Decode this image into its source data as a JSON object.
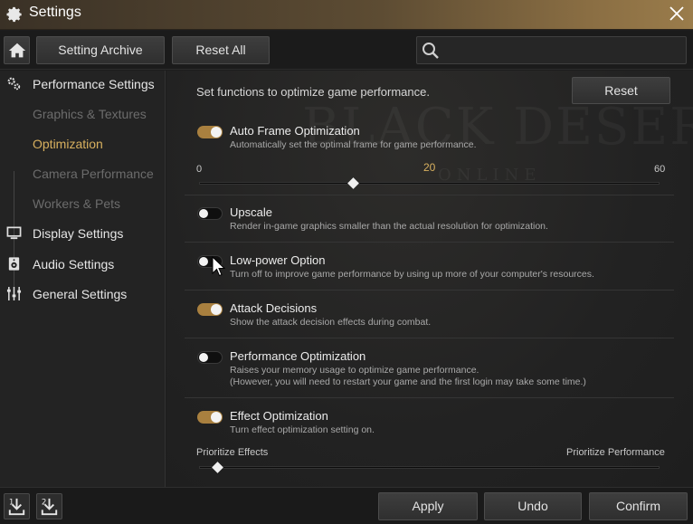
{
  "window": {
    "title": "Settings"
  },
  "toolbar": {
    "setting_archive_label": "Setting Archive",
    "reset_all_label": "Reset All",
    "search_value": "",
    "search_placeholder": ""
  },
  "sidebar": {
    "items": [
      {
        "label": "Performance Settings",
        "level": "main",
        "icon": "performance-gears-icon"
      },
      {
        "label": "Graphics & Textures",
        "level": "sub"
      },
      {
        "label": "Optimization",
        "level": "sub",
        "active": true
      },
      {
        "label": "Camera Performance",
        "level": "sub"
      },
      {
        "label": "Workers & Pets",
        "level": "sub"
      },
      {
        "label": "Display Settings",
        "level": "main",
        "icon": "monitor-icon"
      },
      {
        "label": "Audio Settings",
        "level": "main",
        "icon": "speaker-icon"
      },
      {
        "label": "General Settings",
        "level": "main",
        "icon": "sliders-icon"
      }
    ]
  },
  "content": {
    "intro": "Set functions to optimize game performance.",
    "reset_label": "Reset",
    "options": [
      {
        "name": "Auto Frame Optimization",
        "desc": "Automatically set the optimal frame for game performance.",
        "on": true
      },
      {
        "name": "Upscale",
        "desc": "Render in-game graphics smaller than the actual resolution for optimization.",
        "on": false
      },
      {
        "name": "Low-power Option",
        "desc": "Turn off to improve game performance by using up more of your computer's resources.",
        "on": false
      },
      {
        "name": "Attack Decisions",
        "desc": "Show the attack decision effects during combat.",
        "on": true
      },
      {
        "name": "Performance Optimization",
        "desc": "Raises your memory usage to optimize game performance.",
        "desc2": "(However, you will need to restart your game and the first login may take some time.)",
        "on": false
      },
      {
        "name": "Effect Optimization",
        "desc": "Turn effect optimization setting on.",
        "on": true
      }
    ],
    "frame_slider": {
      "min": "0",
      "max": "60",
      "value": "20",
      "value_num": 20,
      "min_num": 0,
      "max_num": 60
    },
    "effect_slider": {
      "left_label": "Prioritize Effects",
      "right_label": "Prioritize Performance",
      "position_fraction": 0.04
    }
  },
  "footer": {
    "apply_label": "Apply",
    "undo_label": "Undo",
    "confirm_label": "Confirm"
  },
  "colors": {
    "accent": "#d8b05f",
    "toggle_on": "#a9803f",
    "title_bar": "#5d4c33"
  }
}
